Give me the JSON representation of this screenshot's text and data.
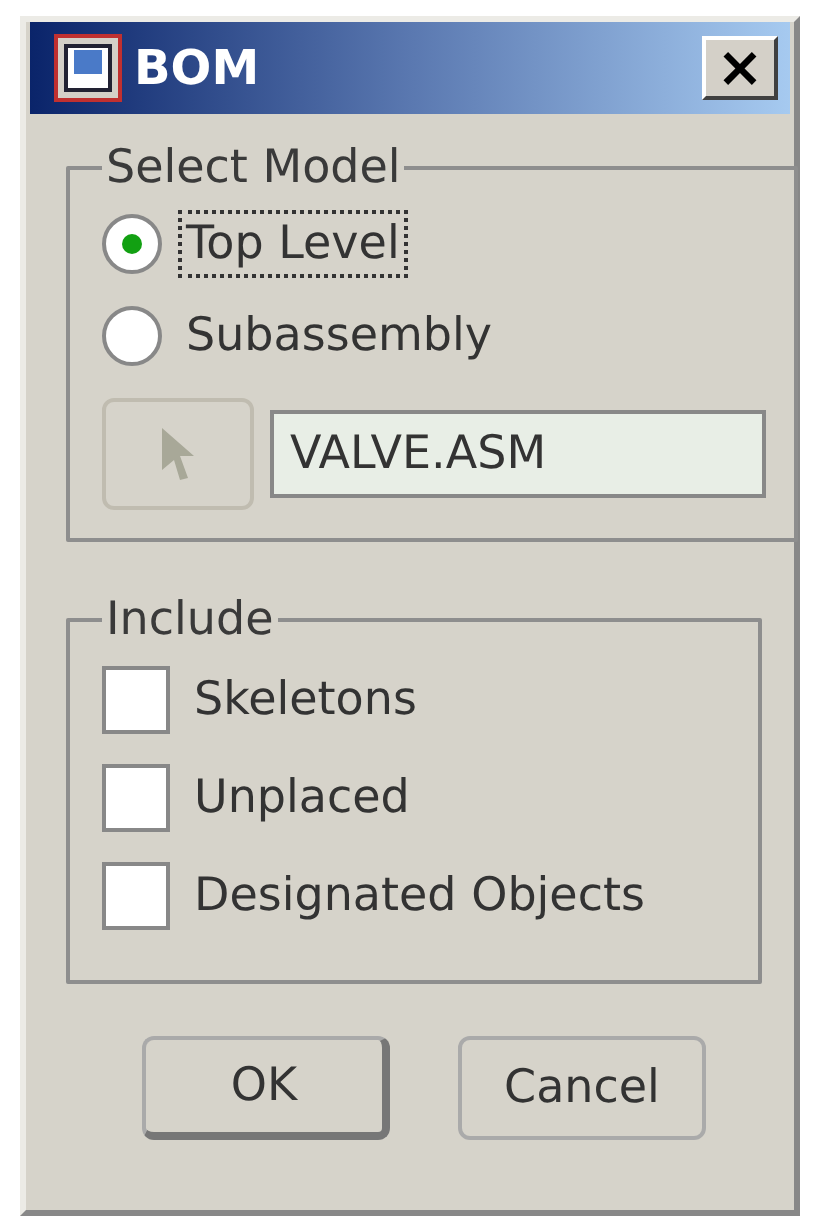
{
  "window": {
    "title": "BOM",
    "close_label": "×"
  },
  "select_model": {
    "title": "Select Model",
    "options": [
      {
        "label": "Top Level",
        "selected": true,
        "focused": true
      },
      {
        "label": "Subassembly",
        "selected": false,
        "focused": false
      }
    ],
    "pick_button": {
      "disabled": true
    },
    "model_field": {
      "value": "VALVE.ASM"
    }
  },
  "include": {
    "title": "Include",
    "items": [
      {
        "label": "Skeletons",
        "checked": false
      },
      {
        "label": "Unplaced",
        "checked": false
      },
      {
        "label": "Designated Objects",
        "checked": false
      }
    ]
  },
  "buttons": [
    {
      "label": "OK",
      "default": true
    },
    {
      "label": "Cancel",
      "default": false
    }
  ]
}
